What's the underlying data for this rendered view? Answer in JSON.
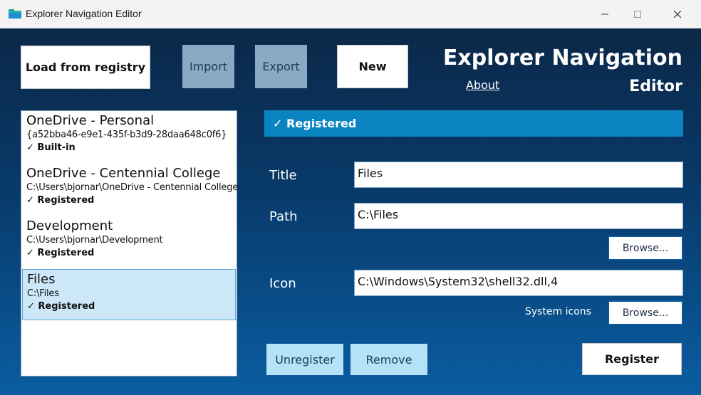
{
  "window": {
    "title": "Explorer Navigation Editor",
    "minimize_icon": "minimize-icon",
    "maximize_icon": "maximize-icon",
    "close_icon": "close-icon"
  },
  "toolbar": {
    "load_label": "Load from registry",
    "import_label": "Import",
    "export_label": "Export",
    "new_label": "New"
  },
  "header": {
    "title_line1": "Explorer Navigation",
    "title_line2": "Editor",
    "about_label": "About"
  },
  "list": {
    "items": [
      {
        "name": "OneDrive - Personal",
        "path": "{a52bba46-e9e1-435f-b3d9-28daa648c0f6}",
        "status": "✓ Built-in"
      },
      {
        "name": "OneDrive - Centennial College",
        "path": "C:\\Users\\bjornar\\OneDrive - Centennial College",
        "status": "✓ Registered"
      },
      {
        "name": "Development",
        "path": "C:\\Users\\bjornar\\Development",
        "status": "✓ Registered"
      },
      {
        "name": "Files",
        "path": "C:\\Files",
        "status": "✓ Registered"
      }
    ]
  },
  "detail": {
    "banner": "✓ Registered",
    "title_label": "Title",
    "title_value": "Files",
    "path_label": "Path",
    "path_value": "C:\\Files",
    "browse_label": "Browse...",
    "icon_label": "Icon",
    "icon_value": "C:\\Windows\\System32\\shell32.dll,4",
    "system_icons_label": "System icons",
    "browse_icon_label": "Browse..."
  },
  "actions": {
    "unregister_label": "Unregister",
    "remove_label": "Remove",
    "register_label": "Register"
  },
  "colors": {
    "banner": "#0a85c2",
    "selected_item": "#cce8f8",
    "light_button": "#b4e3f8",
    "gray_button": "#8aa9c4"
  }
}
